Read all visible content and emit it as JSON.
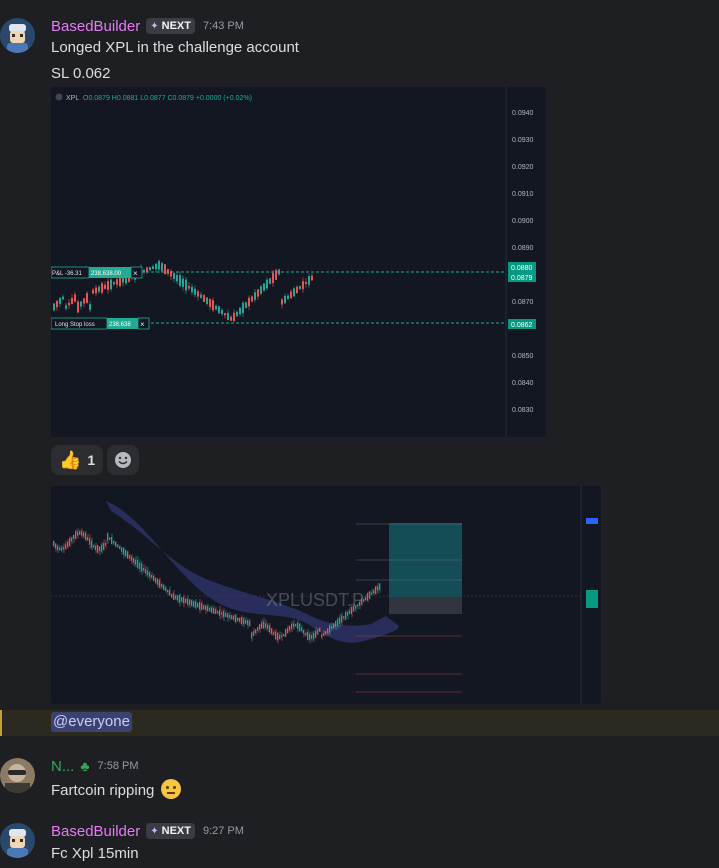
{
  "messages": [
    {
      "username": "BasedBuilder",
      "username_color": "#e47cf5",
      "tag": "NEXT",
      "time": "7:43 PM",
      "lines": [
        "Longed XPL in the challenge account",
        "SL 0.062"
      ]
    },
    {
      "username": "N...",
      "username_color": "#3ba55d",
      "time": "7:58 PM",
      "lines": [
        "Fartcoin ripping"
      ]
    },
    {
      "username": "BasedBuilder",
      "username_color": "#e47cf5",
      "tag": "NEXT",
      "time": "9:27 PM",
      "lines": [
        "Fc Xpl 15min"
      ]
    }
  ],
  "chart1": {
    "symbol": "XPL",
    "ohlc": "O0.0879 H0.0881 L0.0877 C0.0879 +0.0000 (+0.02%)",
    "price_ticks": [
      "0.0940",
      "0.0930",
      "0.0920",
      "0.0910",
      "0.0900",
      "0.0890",
      "0.0880",
      "0.0879",
      "0.0870",
      "0.0862",
      "0.0860",
      "0.0850",
      "0.0840",
      "0.0830"
    ],
    "pnl_label": "P&L -36.31",
    "pnl_qty": "238,638.00",
    "stop_label": "Long Stop loss",
    "stop_qty": "238,638"
  },
  "reactions": [
    {
      "emoji": "thumbs-up",
      "count": "1"
    }
  ],
  "chart2": {
    "watermark": "XPLUSDT.P"
  },
  "mention": "@everyone",
  "colors": {
    "accent_green": "#22ab94",
    "candle_up": "#26a69a",
    "candle_down": "#ef5350",
    "mention_bg": "#3c4270"
  }
}
